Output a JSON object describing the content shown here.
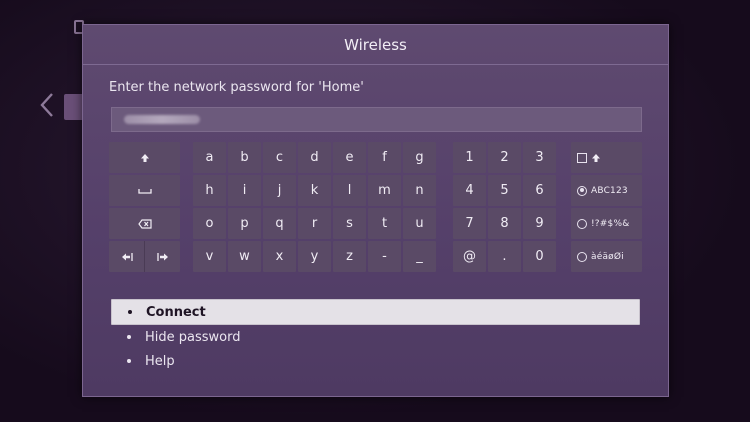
{
  "dialog": {
    "title": "Wireless",
    "prompt": "Enter the network password for 'Home'"
  },
  "password_field": {
    "value": ""
  },
  "keyboard": {
    "function_keys": [
      "shift-icon",
      "space-icon",
      "backspace-icon",
      "cursor-left-icon",
      "cursor-right-icon"
    ],
    "alpha_rows": [
      [
        "a",
        "b",
        "c",
        "d",
        "e",
        "f",
        "g"
      ],
      [
        "h",
        "i",
        "j",
        "k",
        "l",
        "m",
        "n"
      ],
      [
        "o",
        "p",
        "q",
        "r",
        "s",
        "t",
        "u"
      ],
      [
        "v",
        "w",
        "x",
        "y",
        "z",
        "-",
        "_"
      ]
    ],
    "num_rows": [
      [
        "1",
        "2",
        "3"
      ],
      [
        "4",
        "5",
        "6"
      ],
      [
        "7",
        "8",
        "9"
      ],
      [
        "@",
        ".",
        "0"
      ]
    ],
    "modes": [
      {
        "label": "",
        "kind": "checkbox",
        "icon": "shift-icon"
      },
      {
        "label": "ABC123",
        "kind": "radio",
        "selected": true
      },
      {
        "label": "!?#$%&",
        "kind": "radio",
        "selected": false
      },
      {
        "label": "àéäøØi",
        "kind": "radio",
        "selected": false
      }
    ]
  },
  "menu": {
    "items": [
      "Connect",
      "Hide password",
      "Help"
    ],
    "selected_index": 0
  },
  "colors": {
    "dialog_bg": "#5f4a70",
    "key_bg": "#5a4a66",
    "highlight": "#e4e1e7"
  }
}
